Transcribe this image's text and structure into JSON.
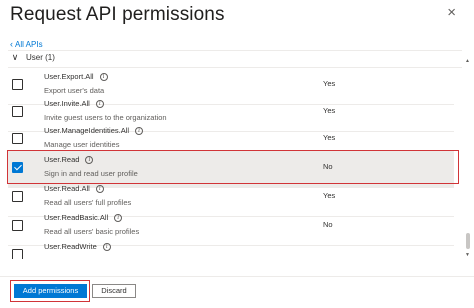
{
  "header": {
    "title": "Request API permissions",
    "close_glyph": "×"
  },
  "nav": {
    "back_chevron": "‹",
    "back_label": "All APIs"
  },
  "group": {
    "chevron": "∨",
    "label": "User (1)"
  },
  "permissions": [
    {
      "name": "User.Export.All",
      "description": "Export user's data",
      "admin_consent": "Yes",
      "checked": false
    },
    {
      "name": "User.Invite.All",
      "description": "Invite guest users to the organization",
      "admin_consent": "Yes",
      "checked": false
    },
    {
      "name": "User.ManageIdentities.All",
      "description": "Manage user identities",
      "admin_consent": "Yes",
      "checked": false
    },
    {
      "name": "User.Read",
      "description": "Sign in and read user profile",
      "admin_consent": "No",
      "checked": true
    },
    {
      "name": "User.Read.All",
      "description": "Read all users' full profiles",
      "admin_consent": "Yes",
      "checked": false
    },
    {
      "name": "User.ReadBasic.All",
      "description": "Read all users' basic profiles",
      "admin_consent": "No",
      "checked": false
    },
    {
      "name": "User.ReadWrite",
      "description": "",
      "admin_consent": "",
      "checked": false
    }
  ],
  "info_glyph": "i",
  "footer": {
    "add_label": "Add permissions",
    "discard_label": "Discard"
  },
  "colors": {
    "accent": "#0078d4",
    "highlight": "#d13438"
  }
}
